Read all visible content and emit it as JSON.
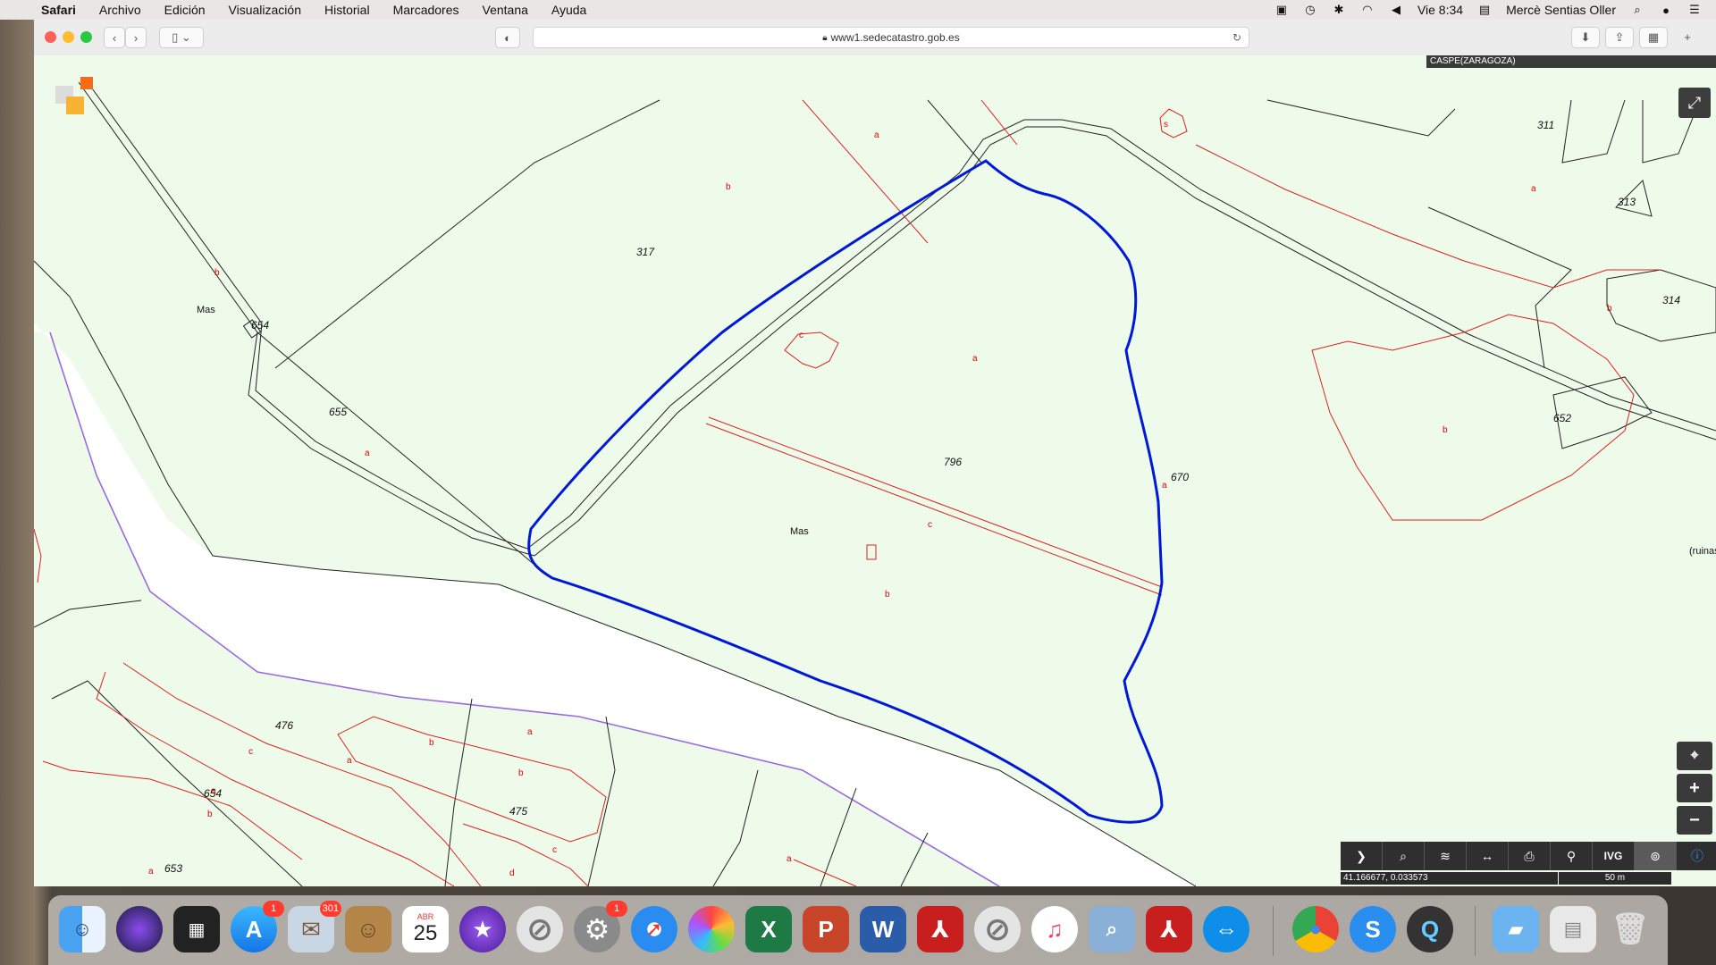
{
  "menubar": {
    "app_name": "Safari",
    "items": [
      "Archivo",
      "Edición",
      "Visualización",
      "Historial",
      "Marcadores",
      "Ventana",
      "Ayuda"
    ],
    "clock": "Vie 8:34",
    "user": "Mercè Sentias Oller"
  },
  "browser": {
    "url": "www1.sedecatastro.gob.es"
  },
  "map": {
    "municipality": "CASPE(ZARAGOZA)",
    "coordinates": "41.166677, 0.033573",
    "scale": "50 m",
    "parcels": [
      "317",
      "654",
      "655",
      "796",
      "670",
      "311",
      "313",
      "314",
      "652",
      "476",
      "475",
      "654",
      "653"
    ],
    "subparcel_letters": [
      "a",
      "b",
      "c",
      "d",
      "s"
    ],
    "place_labels": [
      "Mas",
      "Mas",
      "(ruinas"
    ],
    "colors": {
      "background": "#eefbea",
      "selected_parcel_outline": "#0018d8",
      "subparcel_lines": "#e0201e",
      "river_outline": "#9a6ae0"
    }
  },
  "map_tools": [
    "expand-icon",
    "locate-icon",
    "zoom-in-icon",
    "zoom-out-icon",
    "arrow-right-icon",
    "search-icon",
    "layers-icon",
    "measure-icon",
    "print-icon",
    "pin-icon",
    "ivg-label",
    "binoculars-icon",
    "info-icon"
  ],
  "map_toolbar": {
    "ivg_label": "IVG"
  },
  "dock": {
    "apps": [
      "Finder",
      "Siri",
      "Photo Booth",
      "App Store",
      "Mail",
      "Contacts",
      "Calendar",
      "iMovie",
      "Disabled App",
      "System Preferences",
      "Safari",
      "Photos",
      "Excel",
      "PowerPoint",
      "Word",
      "Acrobat",
      "Disabled App",
      "Music",
      "Preview",
      "Acrobat",
      "TeamViewer",
      "Chrome",
      "Skype",
      "QuickTime",
      "Applications",
      "Downloads",
      "Trash"
    ],
    "calendar_month": "ABR",
    "calendar_day": "25",
    "badges": {
      "app_store": "1",
      "mail": "301",
      "system_prefs": "1"
    }
  }
}
